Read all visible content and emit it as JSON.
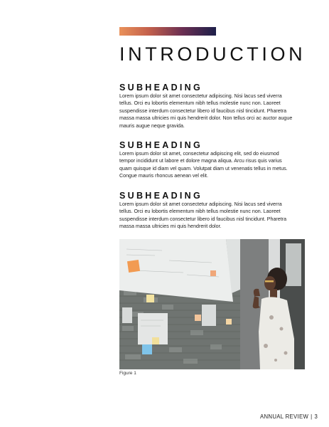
{
  "page": {
    "title": "INTRODUCTION",
    "sections": [
      {
        "heading": "SUBHEADING",
        "lines": [
          "Lorem ipsum dolor sit amet consectetur adipiscing. Nisi lacus sed viverra",
          "tellus. Orci eu lobortis elementum nibh tellus molestie nunc non. Laoreet",
          "suspendisse interdum consectetur libero id faucibus nisl tincidunt. Pharetra",
          "massa massa ultricies mi quis hendrerit dolor. Non tellus orci ac auctor augue",
          "mauris augue neque gravida."
        ]
      },
      {
        "heading": "SUBHEADING",
        "lines": [
          "Lorem ipsum dolor sit amet, consectetur adipiscing elit, sed do eiusmod",
          "tempor incididunt ut labore et dolore magna aliqua. Arcu risus quis varius",
          "quam quisque id diam vel quam. Volutpat diam ut venenatis tellus in metus.",
          "Congue mauris rhoncus aenean vel elit."
        ]
      },
      {
        "heading": "SUBHEADING",
        "lines": [
          "Lorem ipsum dolor sit amet consectetur adipiscing. Nisi lacus sed viverra",
          "tellus. Orci eu lobortis elementum nibh tellus molestie nunc non. Laoreet",
          "suspendisse interdum consectetur libero id faucibus nisl tincidunt. Pharetra",
          "massa massa ultricies mi quis hendrerit dolor."
        ]
      }
    ],
    "figure": {
      "caption": "Figure 1"
    },
    "footer": {
      "label": "ANNUAL REVIEW",
      "separator": "|",
      "page_number": "3"
    }
  },
  "colors": {
    "accent_gradient": [
      "#e9915a",
      "#c4614c",
      "#6b2f52",
      "#1d1f4a"
    ],
    "text": "#1b1b1b"
  }
}
